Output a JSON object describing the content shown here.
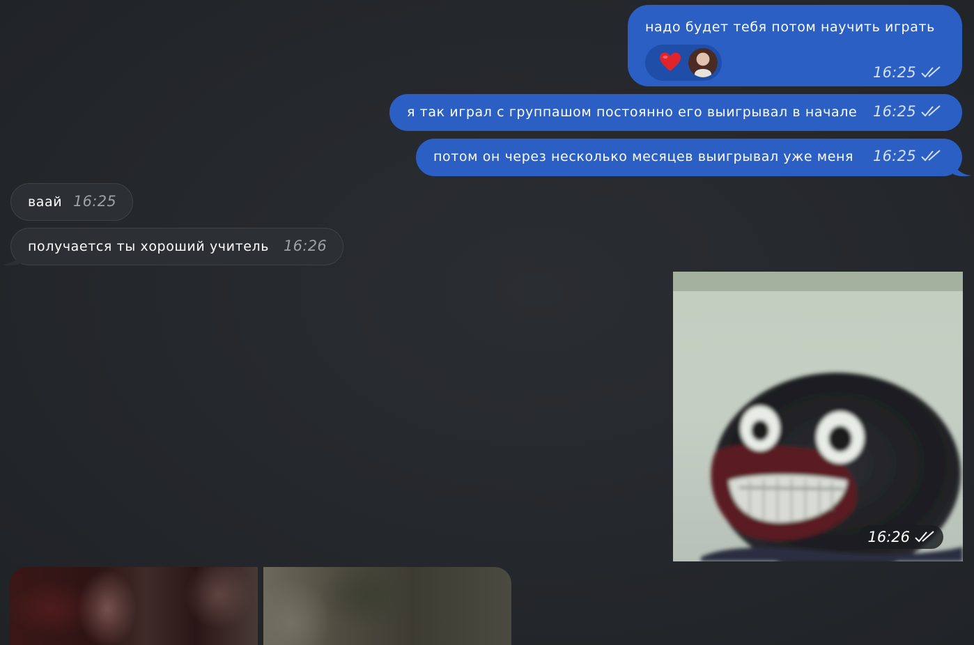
{
  "messages": [
    {
      "id": "b1",
      "direction": "outgoing",
      "text": "надо будет тебя потом научить играть",
      "time": "16:25",
      "status": "read",
      "reactions": [
        {
          "emoji_icon": "heart-icon",
          "emoji": "❤️"
        },
        {
          "icon": "reactor-avatar"
        }
      ]
    },
    {
      "id": "b2",
      "direction": "outgoing",
      "text": "я так играл с группашом постоянно его выигрывал в начале",
      "time": "16:25",
      "status": "read"
    },
    {
      "id": "b3",
      "direction": "outgoing",
      "text": "потом он через несколько месяцев выигрывал уже меня",
      "time": "16:25",
      "status": "read"
    },
    {
      "id": "b4",
      "direction": "incoming",
      "text": "ваай",
      "time": "16:25"
    },
    {
      "id": "b5",
      "direction": "incoming",
      "text": "получается ты хороший учитель",
      "time": "16:26"
    },
    {
      "id": "photo",
      "direction": "outgoing",
      "type": "photo",
      "time": "16:26",
      "status": "read"
    }
  ],
  "colors": {
    "background": "#24272b",
    "outgoing_bubble": "#2b5fc4",
    "incoming_bubble": "#2c2f33",
    "heart": "#e0242c"
  }
}
